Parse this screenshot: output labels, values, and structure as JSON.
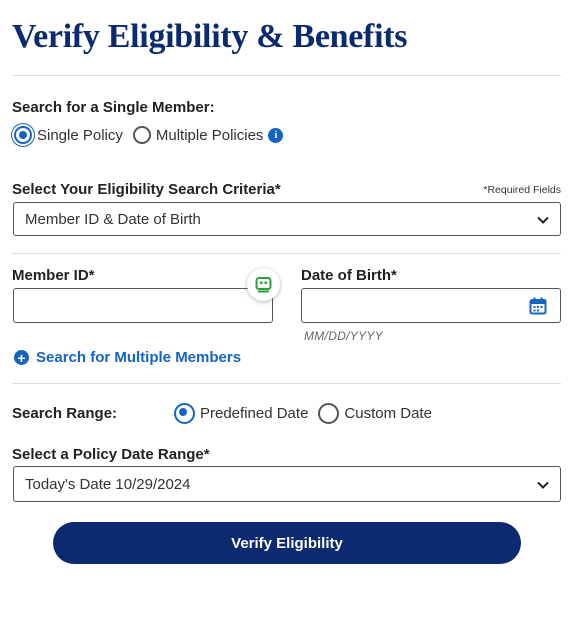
{
  "page": {
    "title": "Verify Eligibility & Benefits"
  },
  "single_member": {
    "label": "Search for a Single Member:",
    "options": [
      "Single Policy",
      "Multiple Policies"
    ],
    "selected": "Single Policy"
  },
  "criteria": {
    "label": "Select Your Eligibility Search Criteria*",
    "required_note": "*Required Fields",
    "value": "Member ID & Date of Birth"
  },
  "member_id": {
    "label": "Member ID*",
    "value": ""
  },
  "dob": {
    "label": "Date of Birth*",
    "value": "",
    "hint": "MM/DD/YYYY"
  },
  "multiple_link": {
    "label": "Search for Multiple Members"
  },
  "search_range": {
    "label": "Search Range:",
    "options": [
      "Predefined Date",
      "Custom Date"
    ],
    "selected": "Predefined Date"
  },
  "policy_date_range": {
    "label": "Select a Policy Date Range*",
    "value": "Today's Date 10/29/2024"
  },
  "submit": {
    "label": "Verify Eligibility"
  },
  "colors": {
    "brand_navy": "#0b2a6f",
    "accent_blue": "#1565c0",
    "float_icon_green": "#2e9e3e"
  },
  "icons": [
    "info-icon",
    "chevron-down-icon",
    "calendar-icon",
    "plus-circle-icon",
    "badge-icon"
  ]
}
